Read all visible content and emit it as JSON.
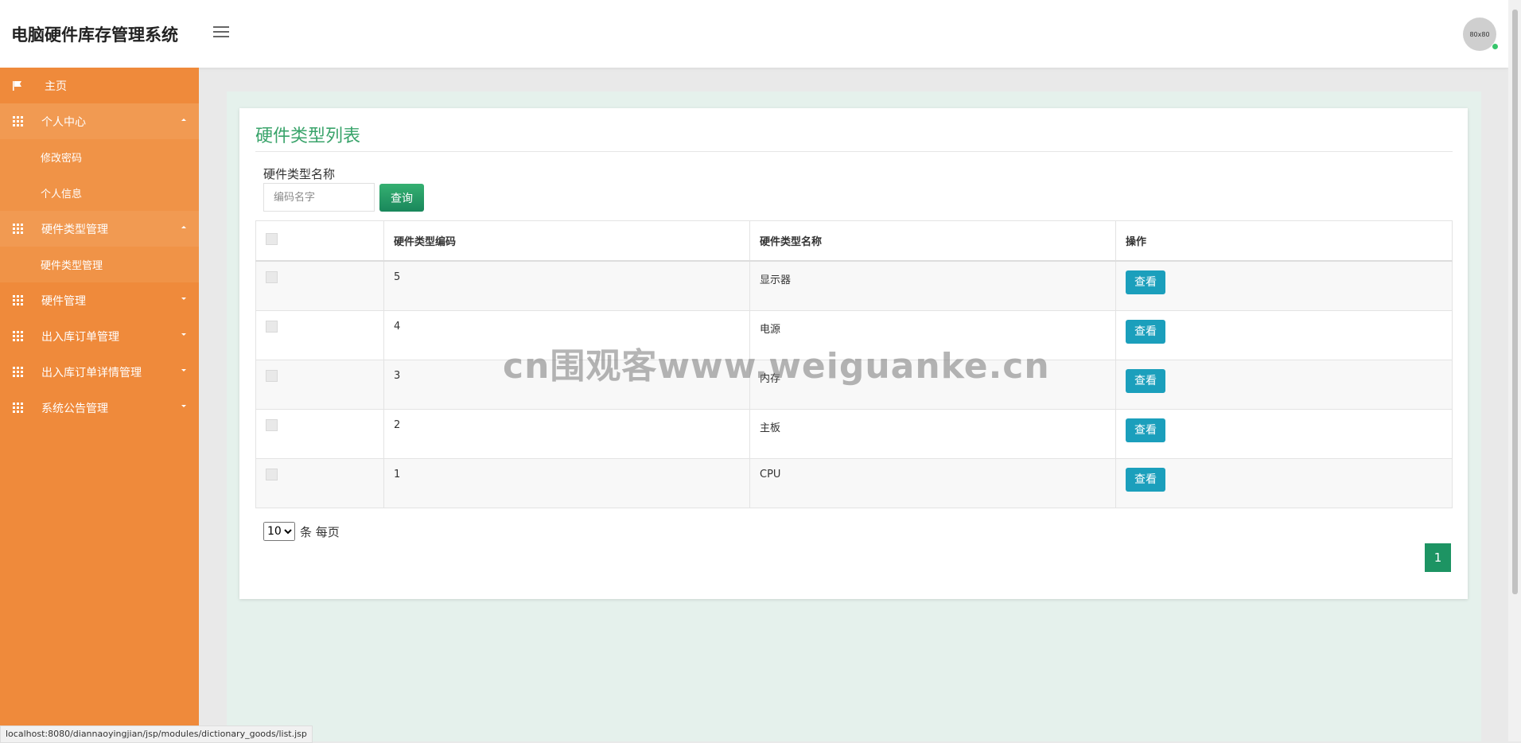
{
  "app": {
    "title": "电脑硬件库存管理系统",
    "avatar_text": "80x80"
  },
  "sidebar": {
    "home": "主页",
    "personal_center": "个人中心",
    "change_password": "修改密码",
    "personal_info": "个人信息",
    "hardware_type_mgmt": "硬件类型管理",
    "hardware_type_mgmt_sub": "硬件类型管理",
    "hardware_mgmt": "硬件管理",
    "inout_order_mgmt": "出入库订单管理",
    "inout_order_detail_mgmt": "出入库订单详情管理",
    "announcement_mgmt": "系统公告管理"
  },
  "main": {
    "title": "硬件类型列表",
    "filter_label": "硬件类型名称",
    "filter_placeholder": "编码名字",
    "query_button": "查询",
    "columns": [
      "硬件类型编码",
      "硬件类型名称",
      "操作"
    ],
    "rows": [
      {
        "code": "5",
        "name": "显示器",
        "action": "查看"
      },
      {
        "code": "4",
        "name": "电源",
        "action": "查看"
      },
      {
        "code": "3",
        "name": "内存",
        "action": "查看"
      },
      {
        "code": "2",
        "name": "主板",
        "action": "查看"
      },
      {
        "code": "1",
        "name": "CPU",
        "action": "查看"
      }
    ],
    "page_size": "10",
    "per_page_label": "条 每页",
    "current_page": "1"
  },
  "watermark": "cn围观客www.weiguanke.cn",
  "status_url": "localhost:8080/diannaoyingjian/jsp/modules/dictionary_goods/list.jsp"
}
